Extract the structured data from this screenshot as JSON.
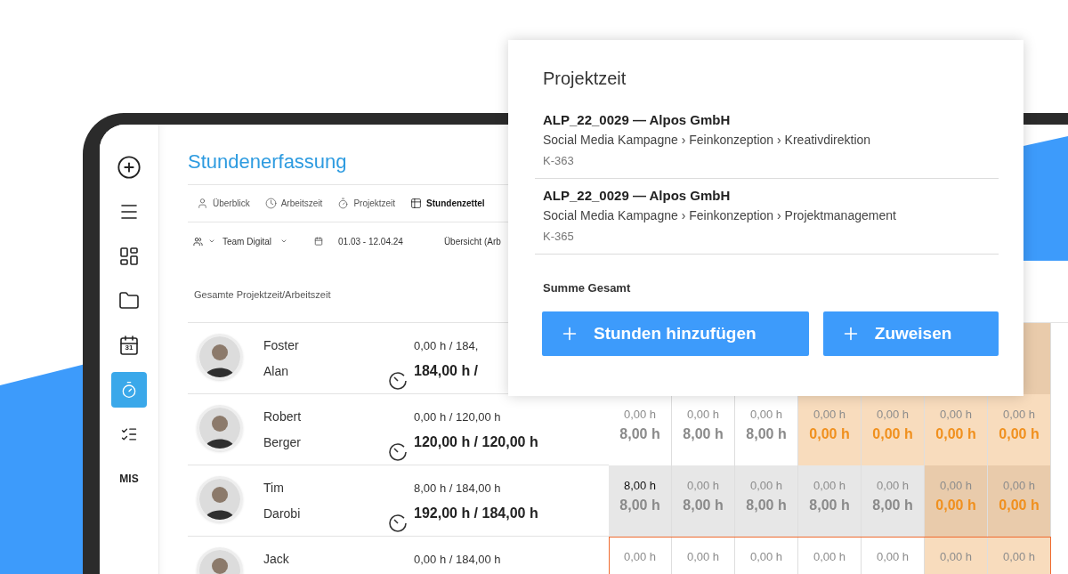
{
  "sidebar": {
    "items": [
      {
        "selected": false
      },
      {
        "selected": false
      },
      {
        "selected": false
      },
      {
        "selected": false
      },
      {
        "selected": false,
        "date": "31"
      },
      {
        "selected": true
      },
      {
        "selected": false
      },
      {
        "selected": false,
        "label": "MIS"
      }
    ]
  },
  "page": {
    "title": "Stundenerfassung"
  },
  "tabs": [
    {
      "label": "Überblick",
      "selected": false
    },
    {
      "label": "Arbeitszeit",
      "selected": false
    },
    {
      "label": "Projektzeit",
      "selected": false
    },
    {
      "label": "Stundenzettel",
      "selected": true
    }
  ],
  "filters": {
    "team": "Team Digital",
    "date_range": "01.03 - 12.04.24",
    "view": "Übersicht (Arb"
  },
  "summary_label": "Gesamte Projektzeit/Arbeitszeit",
  "employees": [
    {
      "first_name": "Foster",
      "last_name": "Alan",
      "recorded": "0,00 h / 184,",
      "total": "184,00 h /",
      "selected": false,
      "cells": [
        {
          "color": "#e9cbab"
        }
      ]
    },
    {
      "first_name": "Robert",
      "last_name": "Berger",
      "recorded": "0,00 h / 120,00 h",
      "total": "120,00 h / 120,00 h",
      "selected": false,
      "cells": [
        {
          "color": "#ffffff",
          "top": "0,00 h",
          "top_strong": false,
          "bottom": "8,00 h",
          "bottom_warning": false
        },
        {
          "color": "#ffffff",
          "top": "0,00 h",
          "top_strong": false,
          "bottom": "8,00 h",
          "bottom_warning": false
        },
        {
          "color": "#ffffff",
          "top": "0,00 h",
          "top_strong": false,
          "bottom": "8,00 h",
          "bottom_warning": false
        },
        {
          "color": "#f8dcbd",
          "top": "0,00 h",
          "top_strong": false,
          "bottom": "0,00 h",
          "bottom_warning": true
        },
        {
          "color": "#f8dcbd",
          "top": "0,00 h",
          "top_strong": false,
          "bottom": "0,00 h",
          "bottom_warning": true
        },
        {
          "color": "#f8dcbd",
          "top": "0,00 h",
          "top_strong": false,
          "bottom": "0,00 h",
          "bottom_warning": true
        },
        {
          "color": "#f8dcbd",
          "top": "0,00 h",
          "top_strong": false,
          "bottom": "0,00 h",
          "bottom_warning": true
        }
      ]
    },
    {
      "first_name": "Tim",
      "last_name": "Darobi",
      "recorded": "8,00 h / 184,00 h",
      "total": "192,00 h / 184,00 h",
      "selected": false,
      "cells": [
        {
          "color": "#e7e7e7",
          "top": "8,00 h",
          "top_strong": true,
          "bottom": "8,00 h",
          "bottom_warning": false
        },
        {
          "color": "#e7e7e7",
          "top": "0,00 h",
          "top_strong": false,
          "bottom": "8,00 h",
          "bottom_warning": false
        },
        {
          "color": "#e7e7e7",
          "top": "0,00 h",
          "top_strong": false,
          "bottom": "8,00 h",
          "bottom_warning": false
        },
        {
          "color": "#e7e7e7",
          "top": "0,00 h",
          "top_strong": false,
          "bottom": "8,00 h",
          "bottom_warning": false
        },
        {
          "color": "#e7e7e7",
          "top": "0,00 h",
          "top_strong": false,
          "bottom": "8,00 h",
          "bottom_warning": false
        },
        {
          "color": "#e9cbab",
          "top": "0,00 h",
          "top_strong": false,
          "bottom": "0,00 h",
          "bottom_warning": true
        },
        {
          "color": "#e9cbab",
          "top": "0,00 h",
          "top_strong": false,
          "bottom": "0,00 h",
          "bottom_warning": true
        }
      ]
    },
    {
      "first_name": "Jack",
      "recorded": "0,00 h / 184,00 h",
      "selected": true,
      "cells": [
        {
          "color": "#ffffff",
          "top": "0,00 h",
          "top_strong": false
        },
        {
          "color": "#ffffff",
          "top": "0,00 h",
          "top_strong": false
        },
        {
          "color": "#ffffff",
          "top": "0,00 h",
          "top_strong": false
        },
        {
          "color": "#ffffff",
          "top": "0,00 h",
          "top_strong": false
        },
        {
          "color": "#ffffff",
          "top": "0,00 h",
          "top_strong": false
        },
        {
          "color": "#f8dcbd",
          "top": "0,00 h",
          "top_strong": false
        },
        {
          "color": "#f8dcbd",
          "top": "0,00 h",
          "top_strong": false
        }
      ]
    }
  ],
  "popup": {
    "title": "Projektzeit",
    "entries": [
      {
        "title": "ALP_22_0029 — Alpos GmbH",
        "path": "Social Media Kampagne › Feinkonzeption › Kreativdirektion",
        "code": "K-363"
      },
      {
        "title": "ALP_22_0029 — Alpos GmbH",
        "path": "Social Media Kampagne › Feinkonzeption › Projektmanagement",
        "code": "K-365"
      }
    ],
    "total_label": "Summe Gesamt",
    "buttons": [
      "Stunden hinzufügen",
      "Zuweisen"
    ]
  }
}
